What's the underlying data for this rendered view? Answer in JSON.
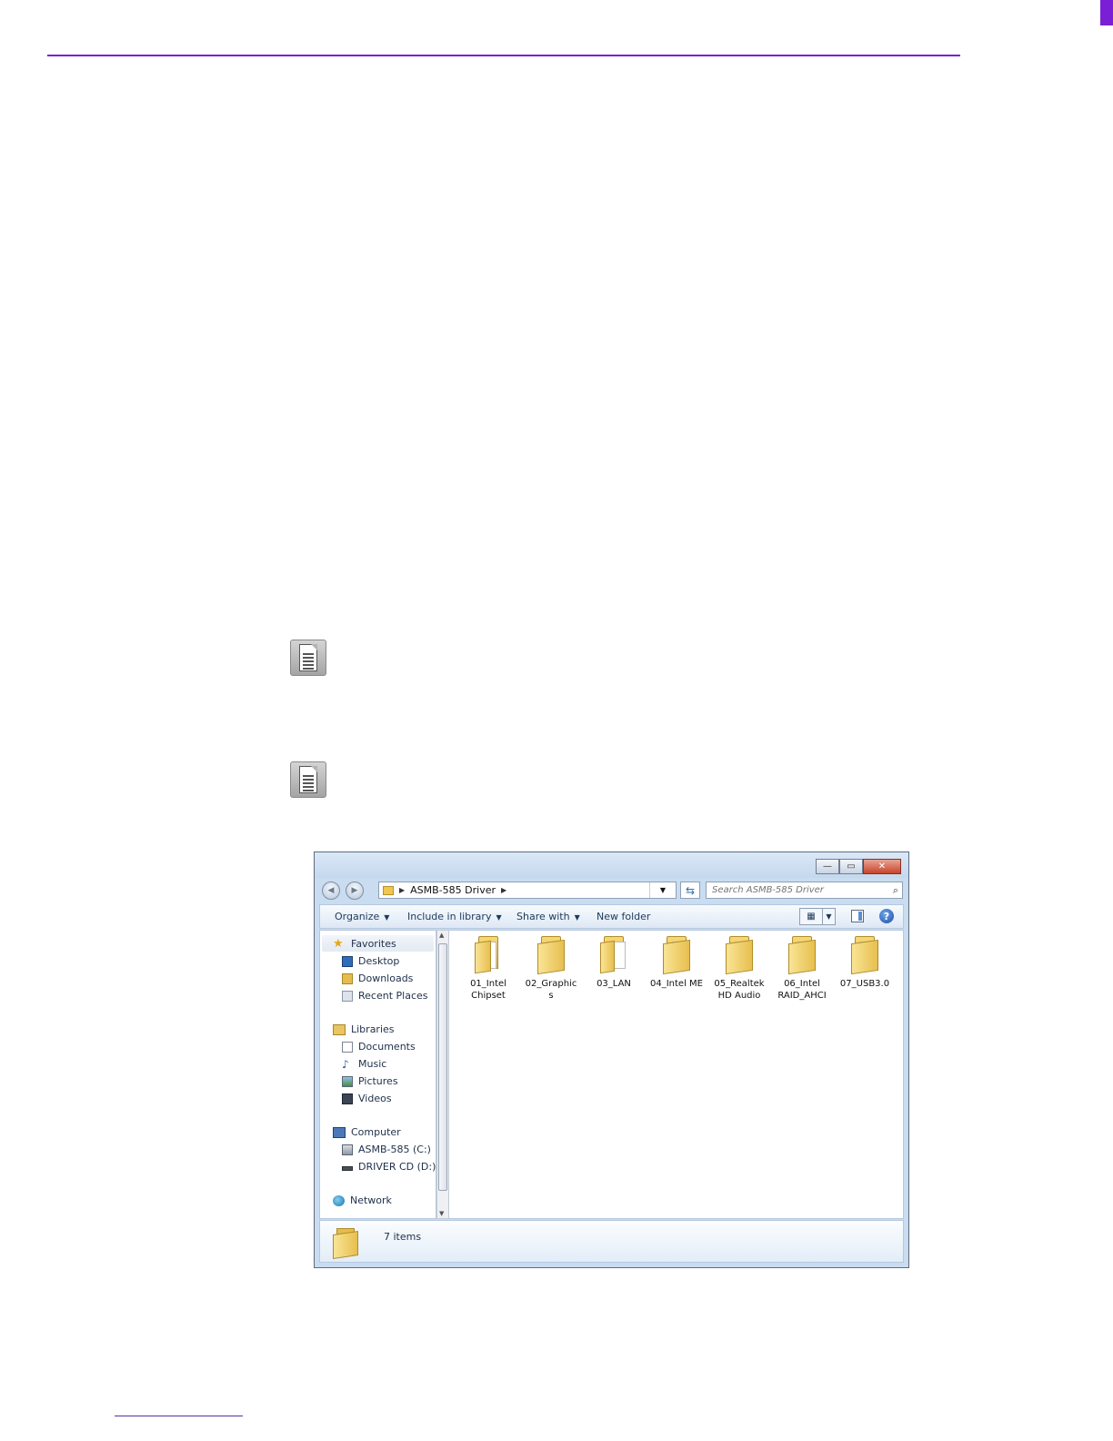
{
  "window": {
    "address_path": "ASMB-585 Driver",
    "search_placeholder": "Search ASMB-585 Driver",
    "min_symbol": "—",
    "max_symbol": "▭",
    "close_symbol": "✕"
  },
  "toolbar": {
    "organize": "Organize",
    "include_in_library": "Include in library",
    "share_with": "Share with",
    "new_folder": "New folder"
  },
  "nav": {
    "favorites": "Favorites",
    "desktop": "Desktop",
    "downloads": "Downloads",
    "recent_places": "Recent Places",
    "libraries": "Libraries",
    "documents": "Documents",
    "music": "Music",
    "pictures": "Pictures",
    "videos": "Videos",
    "computer": "Computer",
    "drive_c": "ASMB-585 (C:)",
    "drive_d": "DRIVER CD (D:)",
    "network": "Network"
  },
  "folders": [
    {
      "line1": "01_Intel",
      "line2": "Chipset"
    },
    {
      "line1": "02_Graphic",
      "line2": "s"
    },
    {
      "line1": "03_LAN",
      "line2": ""
    },
    {
      "line1": "04_Intel ME",
      "line2": ""
    },
    {
      "line1": "05_Realtek",
      "line2": "HD Audio"
    },
    {
      "line1": "06_Intel",
      "line2": "RAID_AHCI"
    },
    {
      "line1": "07_USB3.0",
      "line2": ""
    }
  ],
  "status": {
    "item_count": "7 items"
  },
  "icons": [
    "note-icon",
    "folder-icon",
    "star-icon",
    "desktop-icon",
    "downloads-icon",
    "recent-places-icon",
    "library-icon",
    "documents-icon",
    "music-icon",
    "pictures-icon",
    "videos-icon",
    "computer-icon",
    "drive-icon",
    "network-icon",
    "search-icon",
    "help-icon",
    "refresh-icon",
    "back-icon",
    "forward-icon"
  ],
  "colors": {
    "accent_rule": "#7a1fd6",
    "window_frame": "#c9dcf0",
    "folder_yellow": "#f0c650"
  }
}
